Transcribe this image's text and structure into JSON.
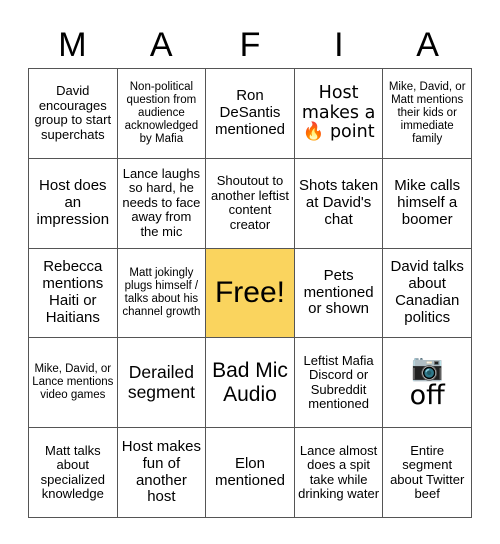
{
  "card": {
    "title_letters": [
      "M",
      "A",
      "F",
      "I",
      "A"
    ],
    "free_color": "#fad45e",
    "grid_line_color": "#555555",
    "background_color": "#ffffff",
    "text_color": "#000000"
  },
  "cells": [
    {
      "id": "r1c1",
      "text": "David encourages group to start superchats",
      "size": "s",
      "free": false
    },
    {
      "id": "r1c2",
      "text": "Non-political question from audience acknowledged by Mafia",
      "size": "xs",
      "free": false
    },
    {
      "id": "r1c3",
      "text": "Ron DeSantis mentioned",
      "size": "m",
      "free": false
    },
    {
      "id": "r1c4",
      "text": "Host makes a 🔥 point",
      "size": "l",
      "free": false
    },
    {
      "id": "r1c5",
      "text": "Mike, David, or Matt mentions their kids or immediate family",
      "size": "xs",
      "free": false
    },
    {
      "id": "r2c1",
      "text": "Host does an impression",
      "size": "m",
      "free": false
    },
    {
      "id": "r2c2",
      "text": "Lance laughs so hard, he needs to face away from the mic",
      "size": "s",
      "free": false
    },
    {
      "id": "r2c3",
      "text": "Shoutout to another leftist content creator",
      "size": "s",
      "free": false
    },
    {
      "id": "r2c4",
      "text": "Shots taken at David's chat",
      "size": "m",
      "free": false
    },
    {
      "id": "r2c5",
      "text": "Mike calls himself a boomer",
      "size": "m",
      "free": false
    },
    {
      "id": "r3c1",
      "text": "Rebecca mentions Haiti or Haitians",
      "size": "m",
      "free": false
    },
    {
      "id": "r3c2",
      "text": "Matt jokingly plugs himself / talks about his channel growth",
      "size": "xs",
      "free": false
    },
    {
      "id": "r3c3",
      "text": "Free!",
      "size": "free",
      "free": true
    },
    {
      "id": "r3c4",
      "text": "Pets mentioned or shown",
      "size": "m",
      "free": false
    },
    {
      "id": "r3c5",
      "text": "David talks about Canadian politics",
      "size": "m",
      "free": false
    },
    {
      "id": "r4c1",
      "text": "Mike, David, or Lance mentions video games",
      "size": "xs",
      "free": false
    },
    {
      "id": "r4c2",
      "text": "Derailed segment",
      "size": "l",
      "free": false
    },
    {
      "id": "r4c3",
      "text": "Bad Mic Audio",
      "size": "xl",
      "free": false
    },
    {
      "id": "r4c4",
      "text": "Leftist Mafia Discord or Subreddit mentioned",
      "size": "s",
      "free": false
    },
    {
      "id": "r4c5",
      "text": "📷 off",
      "size": "xl",
      "free": false
    },
    {
      "id": "r5c1",
      "text": "Matt talks about specialized knowledge",
      "size": "s",
      "free": false
    },
    {
      "id": "r5c2",
      "text": "Host makes fun of another host",
      "size": "m",
      "free": false
    },
    {
      "id": "r5c3",
      "text": "Elon mentioned",
      "size": "m",
      "free": false
    },
    {
      "id": "r5c4",
      "text": "Lance almost does a spit take while drinking water",
      "size": "s",
      "free": false
    },
    {
      "id": "r5c5",
      "text": "Entire segment about Twitter beef",
      "size": "s",
      "free": false
    }
  ]
}
